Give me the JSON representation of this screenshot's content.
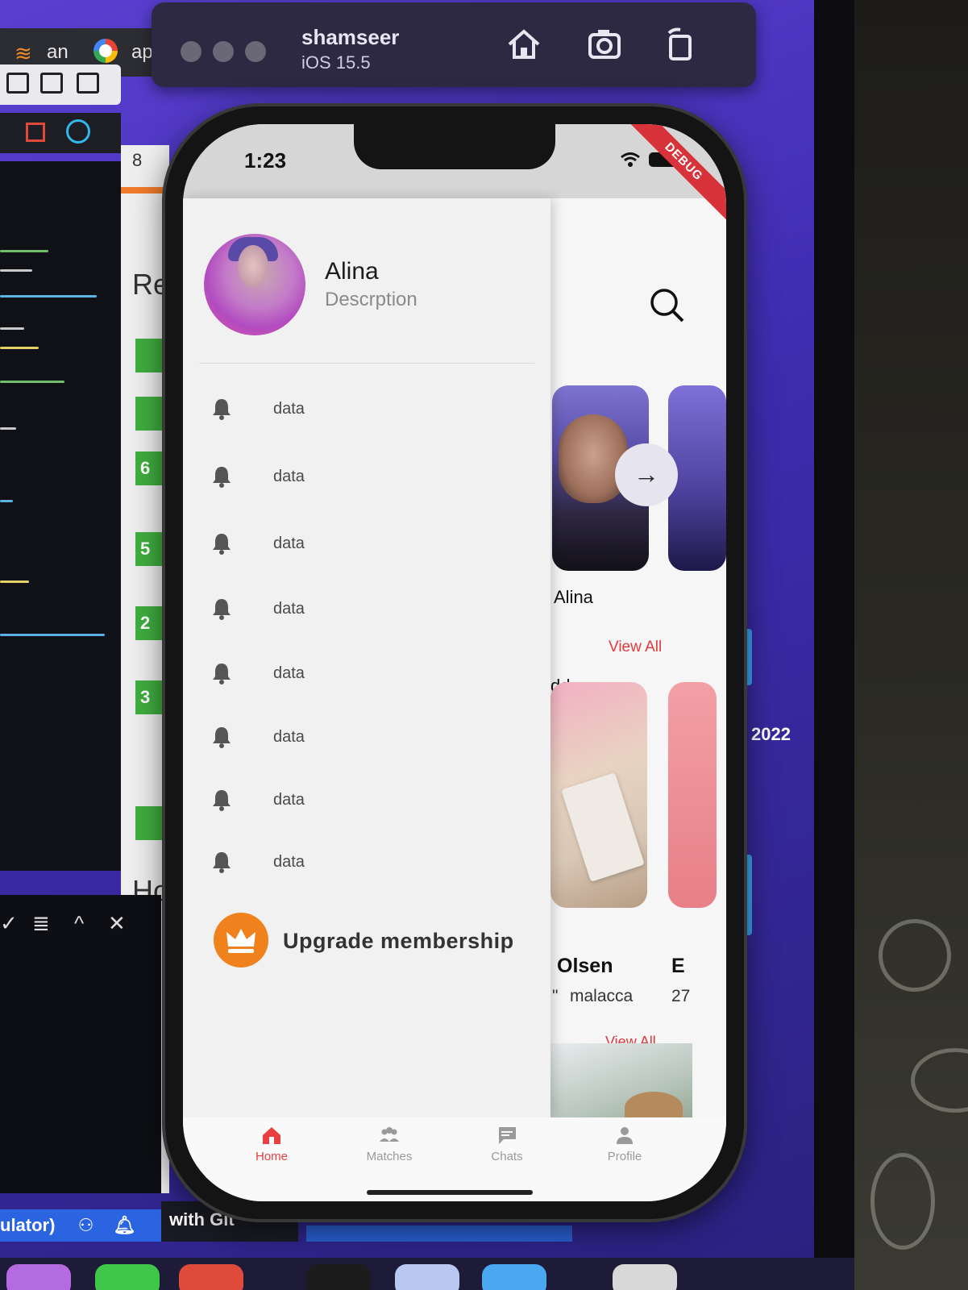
{
  "browser": {
    "tab_1": "an",
    "tab_2": "ap"
  },
  "simulator": {
    "device_name": "shamseer",
    "os_version": "iOS 15.5"
  },
  "ide": {
    "panel_letters": [
      "8",
      "Re",
      "6",
      "5",
      "2",
      "3",
      "Ho"
    ],
    "status_text": "ulator)",
    "status_mid": "with Git",
    "year_label": "2022"
  },
  "phone": {
    "time": "1:23",
    "debug_banner": "DEBUG"
  },
  "drawer": {
    "profile": {
      "name": "Alina",
      "description": "Descrption"
    },
    "items": [
      {
        "label": "data",
        "icon": "bell-icon"
      },
      {
        "label": "data",
        "icon": "bell-icon"
      },
      {
        "label": "data",
        "icon": "bell-icon"
      },
      {
        "label": "data",
        "icon": "bell-icon"
      },
      {
        "label": "data",
        "icon": "bell-icon"
      },
      {
        "label": "data",
        "icon": "bell-icon"
      },
      {
        "label": "data",
        "icon": "bell-icon"
      },
      {
        "label": "data",
        "icon": "bell-icon"
      }
    ],
    "upgrade_label": "Upgrade membership"
  },
  "main": {
    "card_1_name": "Alina",
    "view_all_1": "View All",
    "section_2_partial": "dd",
    "card_2_name": "Olsen",
    "card_2_location": "malacca",
    "card_2_quote": "\"",
    "card_3_name_partial": "E",
    "card_3_age_partial": "27",
    "view_all_2": "View All"
  },
  "bottom_nav": {
    "items": [
      {
        "label": "Home",
        "active": true
      },
      {
        "label": "Matches",
        "active": false
      },
      {
        "label": "Chats",
        "active": false
      },
      {
        "label": "Profile",
        "active": false
      }
    ],
    "active_color": "#e8403f",
    "inactive_color": "#9a9a9a"
  },
  "colors": {
    "accent_red": "#e03a40",
    "crown_orange": "#f0821e"
  }
}
